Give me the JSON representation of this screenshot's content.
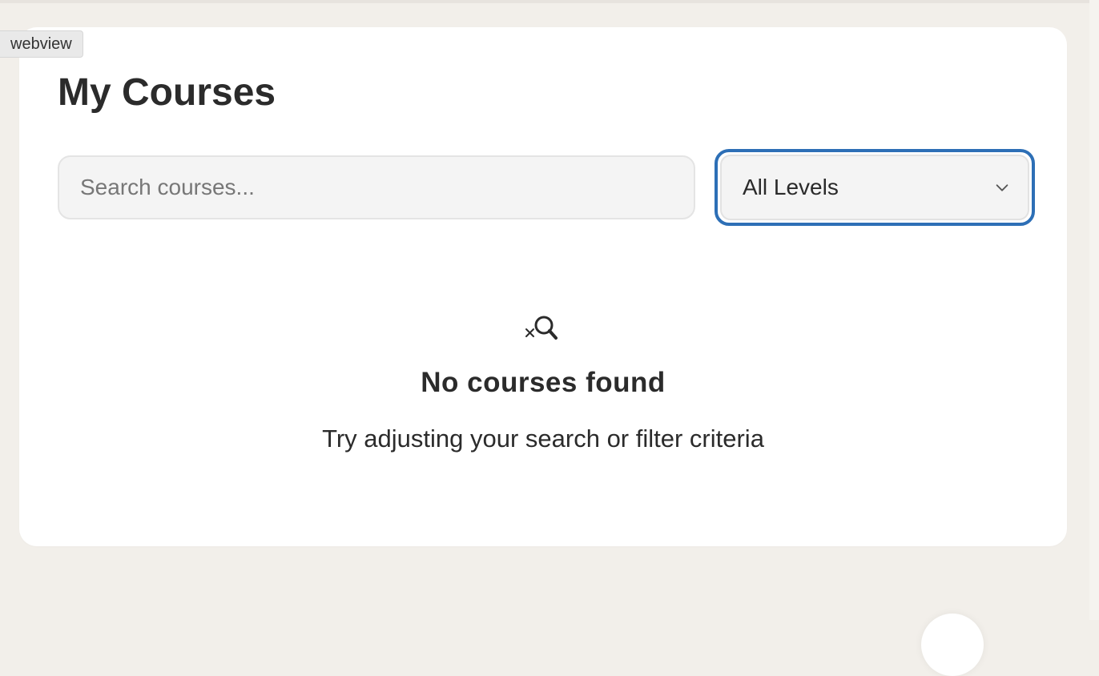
{
  "app": {
    "badge": "webview"
  },
  "page": {
    "title": "My Courses"
  },
  "filters": {
    "search_placeholder": "Search courses...",
    "level_selected": "All Levels"
  },
  "empty_state": {
    "icon": "search-x-icon",
    "title": "No courses found",
    "subtitle": "Try adjusting your search or filter criteria"
  },
  "colors": {
    "background": "#f2efea",
    "card": "#ffffff",
    "focus_ring": "#2d6fb6",
    "text": "#2b2b2b"
  }
}
